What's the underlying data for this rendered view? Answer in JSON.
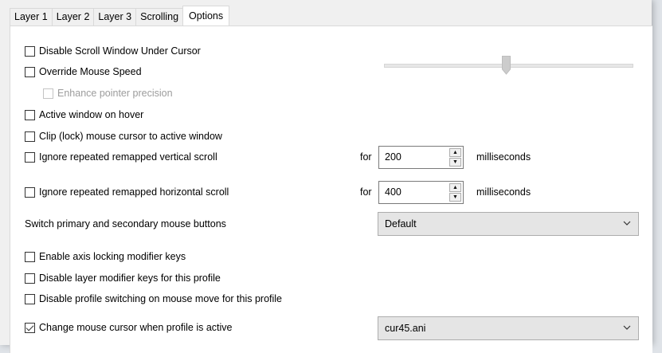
{
  "tabs": [
    {
      "label": "Layer 1",
      "active": false
    },
    {
      "label": "Layer 2",
      "active": false
    },
    {
      "label": "Layer 3",
      "active": false
    },
    {
      "label": "Scrolling",
      "active": false
    },
    {
      "label": "Options",
      "active": true
    }
  ],
  "options": {
    "disable_scroll_window": {
      "label": "Disable Scroll Window Under Cursor",
      "checked": false
    },
    "override_mouse_speed": {
      "label": "Override Mouse Speed",
      "checked": false
    },
    "enhance_pointer_precision": {
      "label": "Enhance pointer precision",
      "checked": false,
      "disabled": true
    },
    "active_window_on_hover": {
      "label": "Active window on hover",
      "checked": false
    },
    "clip_mouse_cursor": {
      "label": "Clip (lock) mouse cursor to active window",
      "checked": false
    },
    "ignore_vertical_scroll": {
      "label": "Ignore repeated remapped vertical scroll",
      "checked": false,
      "for_label": "for",
      "value": "200",
      "unit": "milliseconds"
    },
    "ignore_horizontal_scroll": {
      "label": "Ignore repeated remapped horizontal scroll",
      "checked": false,
      "for_label": "for",
      "value": "400",
      "unit": "milliseconds"
    },
    "switch_buttons": {
      "label": "Switch primary and secondary mouse buttons",
      "selected": "Default"
    },
    "enable_axis_locking": {
      "label": "Enable axis locking modifier keys",
      "checked": false
    },
    "disable_layer_modifier": {
      "label": "Disable layer modifier keys for this profile",
      "checked": false
    },
    "disable_profile_switching": {
      "label": "Disable profile switching on mouse move for this profile",
      "checked": false
    },
    "change_mouse_cursor": {
      "label": "Change mouse cursor when profile is active",
      "checked": true,
      "selected": "cur45.ani"
    }
  },
  "mouse_speed_slider": {
    "value": 0.5,
    "disabled": true
  }
}
